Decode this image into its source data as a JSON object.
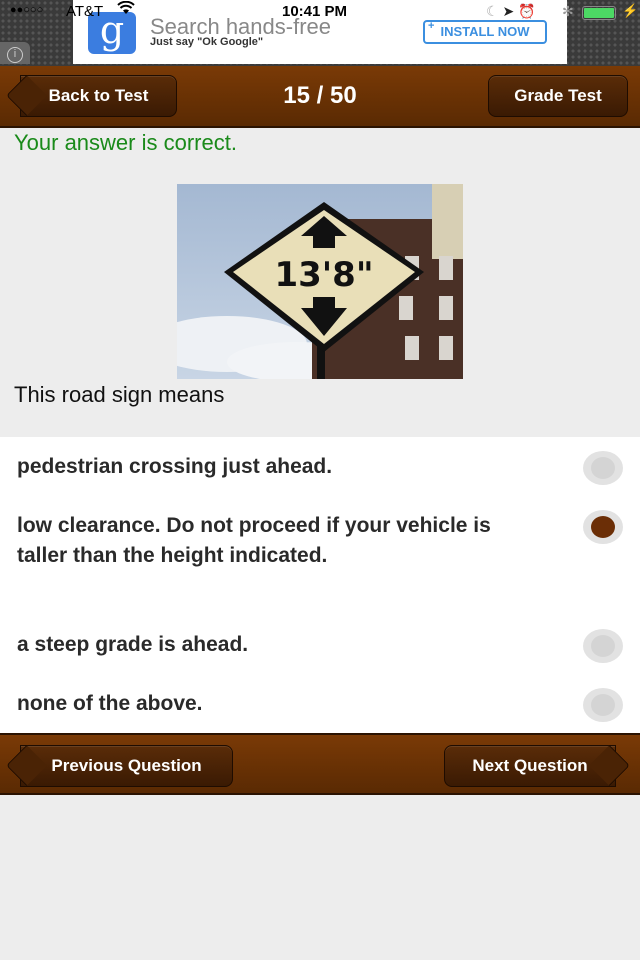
{
  "status_bar": {
    "signal": "●●○○○",
    "carrier": "AT&T",
    "time": "10:41 PM",
    "icons": [
      "moon-icon",
      "location-icon",
      "alarm-icon",
      "bluetooth-icon"
    ],
    "battery_percent": 100
  },
  "ad": {
    "logo_letter": "g",
    "title": "Search hands-free",
    "subtitle": "Just say \"Ok Google\"",
    "install_plus": "+",
    "install_label": "INSTALL NOW",
    "info_glyph": "i"
  },
  "header": {
    "back_label": "Back to Test",
    "counter": "15 / 50",
    "grade_label": "Grade Test"
  },
  "feedback": {
    "text": "Your answer is correct.",
    "color": "#1a8a1a"
  },
  "question": {
    "image_alt": "Diamond road sign reading 13' 8\" with up and down arrows",
    "sign_text": "13'8\"",
    "prompt": "This road sign means"
  },
  "answers": [
    {
      "text": "pedestrian crossing just ahead.",
      "selected": false
    },
    {
      "text": "low clearance. Do not proceed if your vehicle is taller than the height indicated.",
      "selected": true
    },
    {
      "text": "a steep grade is ahead.",
      "selected": false
    },
    {
      "text": "none of the above.",
      "selected": false
    }
  ],
  "footer": {
    "prev_label": "Previous Question",
    "next_label": "Next Question"
  },
  "colors": {
    "brand_brown": "#6b2e06",
    "correct_green": "#1a8a1a"
  }
}
